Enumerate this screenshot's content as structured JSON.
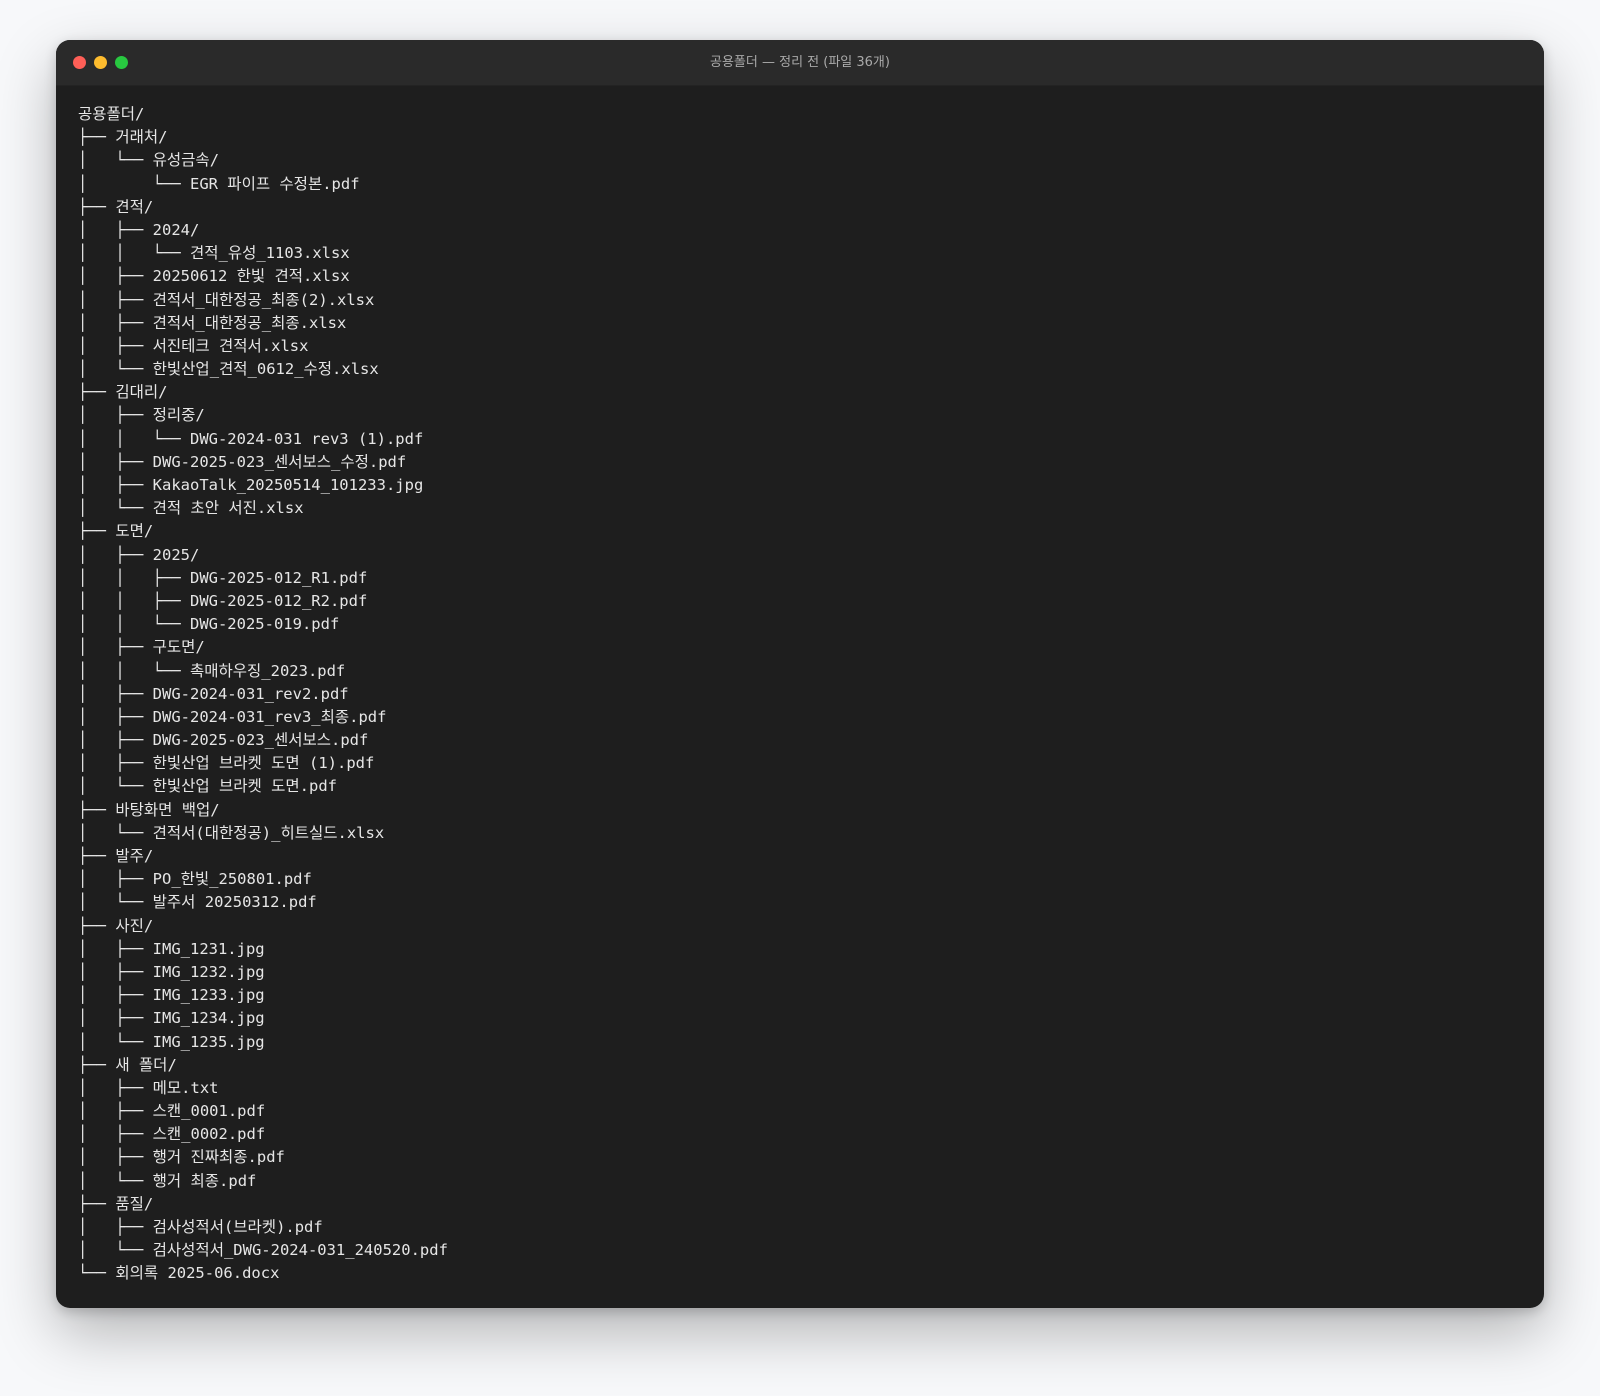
{
  "window": {
    "title": "공용폴더 — 정리 전 (파일 36개)"
  },
  "tree": {
    "lines": [
      "공용폴더/",
      "├── 거래처/",
      "│   └── 유성금속/",
      "│       └── EGR 파이프 수정본.pdf",
      "├── 견적/",
      "│   ├── 2024/",
      "│   │   └── 견적_유성_1103.xlsx",
      "│   ├── 20250612 한빛 견적.xlsx",
      "│   ├── 견적서_대한정공_최종(2).xlsx",
      "│   ├── 견적서_대한정공_최종.xlsx",
      "│   ├── 서진테크 견적서.xlsx",
      "│   └── 한빛산업_견적_0612_수정.xlsx",
      "├── 김대리/",
      "│   ├── 정리중/",
      "│   │   └── DWG-2024-031 rev3 (1).pdf",
      "│   ├── DWG-2025-023_센서보스_수정.pdf",
      "│   ├── KakaoTalk_20250514_101233.jpg",
      "│   └── 견적 초안 서진.xlsx",
      "├── 도면/",
      "│   ├── 2025/",
      "│   │   ├── DWG-2025-012_R1.pdf",
      "│   │   ├── DWG-2025-012_R2.pdf",
      "│   │   └── DWG-2025-019.pdf",
      "│   ├── 구도면/",
      "│   │   └── 촉매하우징_2023.pdf",
      "│   ├── DWG-2024-031_rev2.pdf",
      "│   ├── DWG-2024-031_rev3_최종.pdf",
      "│   ├── DWG-2025-023_센서보스.pdf",
      "│   ├── 한빛산업 브라켓 도면 (1).pdf",
      "│   └── 한빛산업 브라켓 도면.pdf",
      "├── 바탕화면 백업/",
      "│   └── 견적서(대한정공)_히트실드.xlsx",
      "├── 발주/",
      "│   ├── PO_한빛_250801.pdf",
      "│   └── 발주서 20250312.pdf",
      "├── 사진/",
      "│   ├── IMG_1231.jpg",
      "│   ├── IMG_1232.jpg",
      "│   ├── IMG_1233.jpg",
      "│   ├── IMG_1234.jpg",
      "│   └── IMG_1235.jpg",
      "├── 새 폴더/",
      "│   ├── 메모.txt",
      "│   ├── 스캔_0001.pdf",
      "│   ├── 스캔_0002.pdf",
      "│   ├── 행거 진짜최종.pdf",
      "│   └── 행거 최종.pdf",
      "├── 품질/",
      "│   ├── 검사성적서(브라켓).pdf",
      "│   └── 검사성적서_DWG-2024-031_240520.pdf",
      "└── 회의록 2025-06.docx"
    ]
  }
}
